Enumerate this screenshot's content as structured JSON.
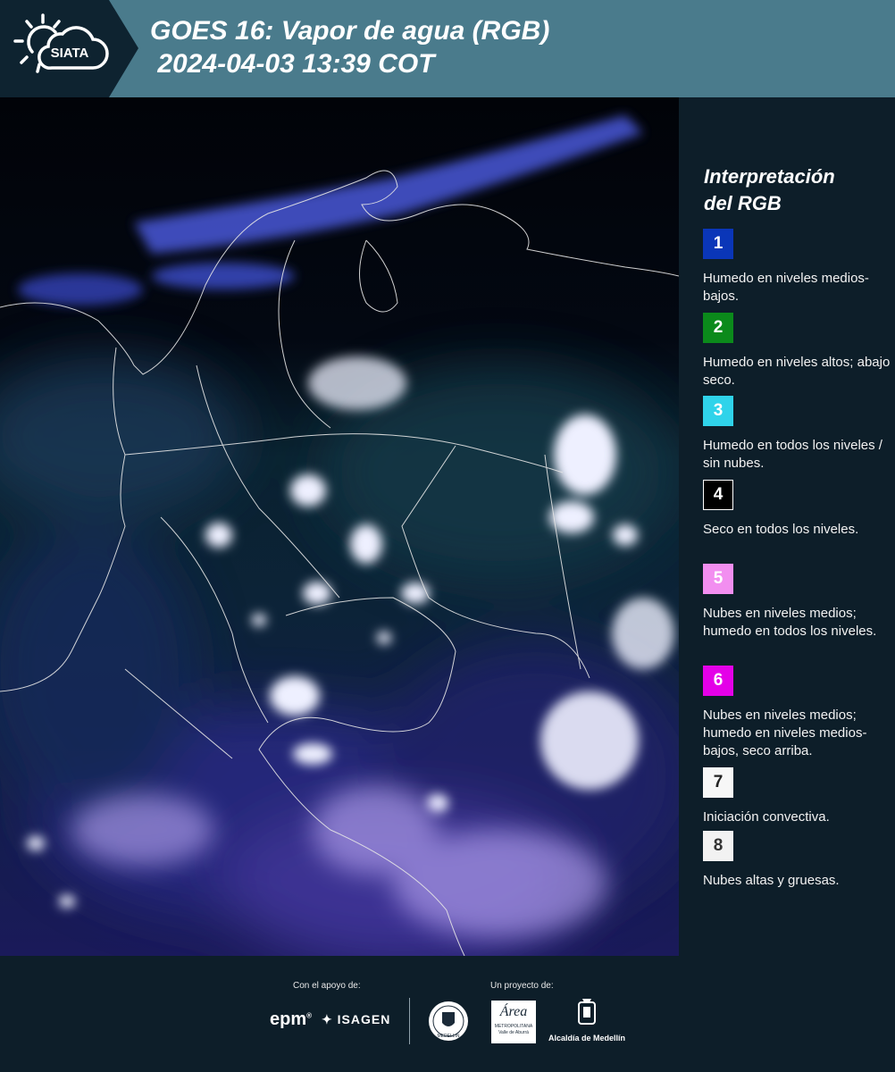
{
  "header": {
    "brand": "SIATA",
    "title_line1": "GOES 16: Vapor de agua (RGB)",
    "title_line2": " 2024-04-03 13:39 COT"
  },
  "map": {
    "icon": "satellite-water-vapor-map"
  },
  "legend": {
    "title_line1": "Interpretación",
    "title_line2": "del RGB",
    "items": [
      {
        "num": "1",
        "color": "#0a36b8",
        "text_color": "#ffffff",
        "text": "Humedo en niveles medios-bajos."
      },
      {
        "num": "2",
        "color": "#0b8a1b",
        "text_color": "#ffffff",
        "text": "Humedo en niveles altos; abajo seco."
      },
      {
        "num": "3",
        "color": "#2fd3ea",
        "text_color": "#ffffff",
        "text": "Humedo en todos los niveles / sin nubes."
      },
      {
        "num": "4",
        "color": "#000000",
        "text_color": "#ffffff",
        "text": "Seco en todos los niveles."
      },
      {
        "num": "5",
        "color": "#f28ef0",
        "text_color": "#ffffff",
        "text": "Nubes en niveles medios; humedo en todos los niveles."
      },
      {
        "num": "6",
        "color": "#e400e8",
        "text_color": "#ffffff",
        "text": "Nubes en niveles medios; humedo en niveles medios-bajos, seco arriba."
      },
      {
        "num": "7",
        "color": "#f7f7f7",
        "text_color": "#222222",
        "text": "Iniciación convectiva."
      },
      {
        "num": "8",
        "color": "#f2f2f2",
        "text_color": "#333333",
        "text": "Nubes altas y gruesas."
      }
    ]
  },
  "footer": {
    "support_label": "Con el apoyo de:",
    "project_label": "Un proyecto de:",
    "epm": "epm",
    "isagen": "ISAGEN",
    "area_name": "Área",
    "area_sub1": "METROPOLITANA",
    "area_sub2": "Valle de Aburrá",
    "alcaldia": "Alcaldía de Medellín",
    "seal_text": "MEDELLIN"
  }
}
